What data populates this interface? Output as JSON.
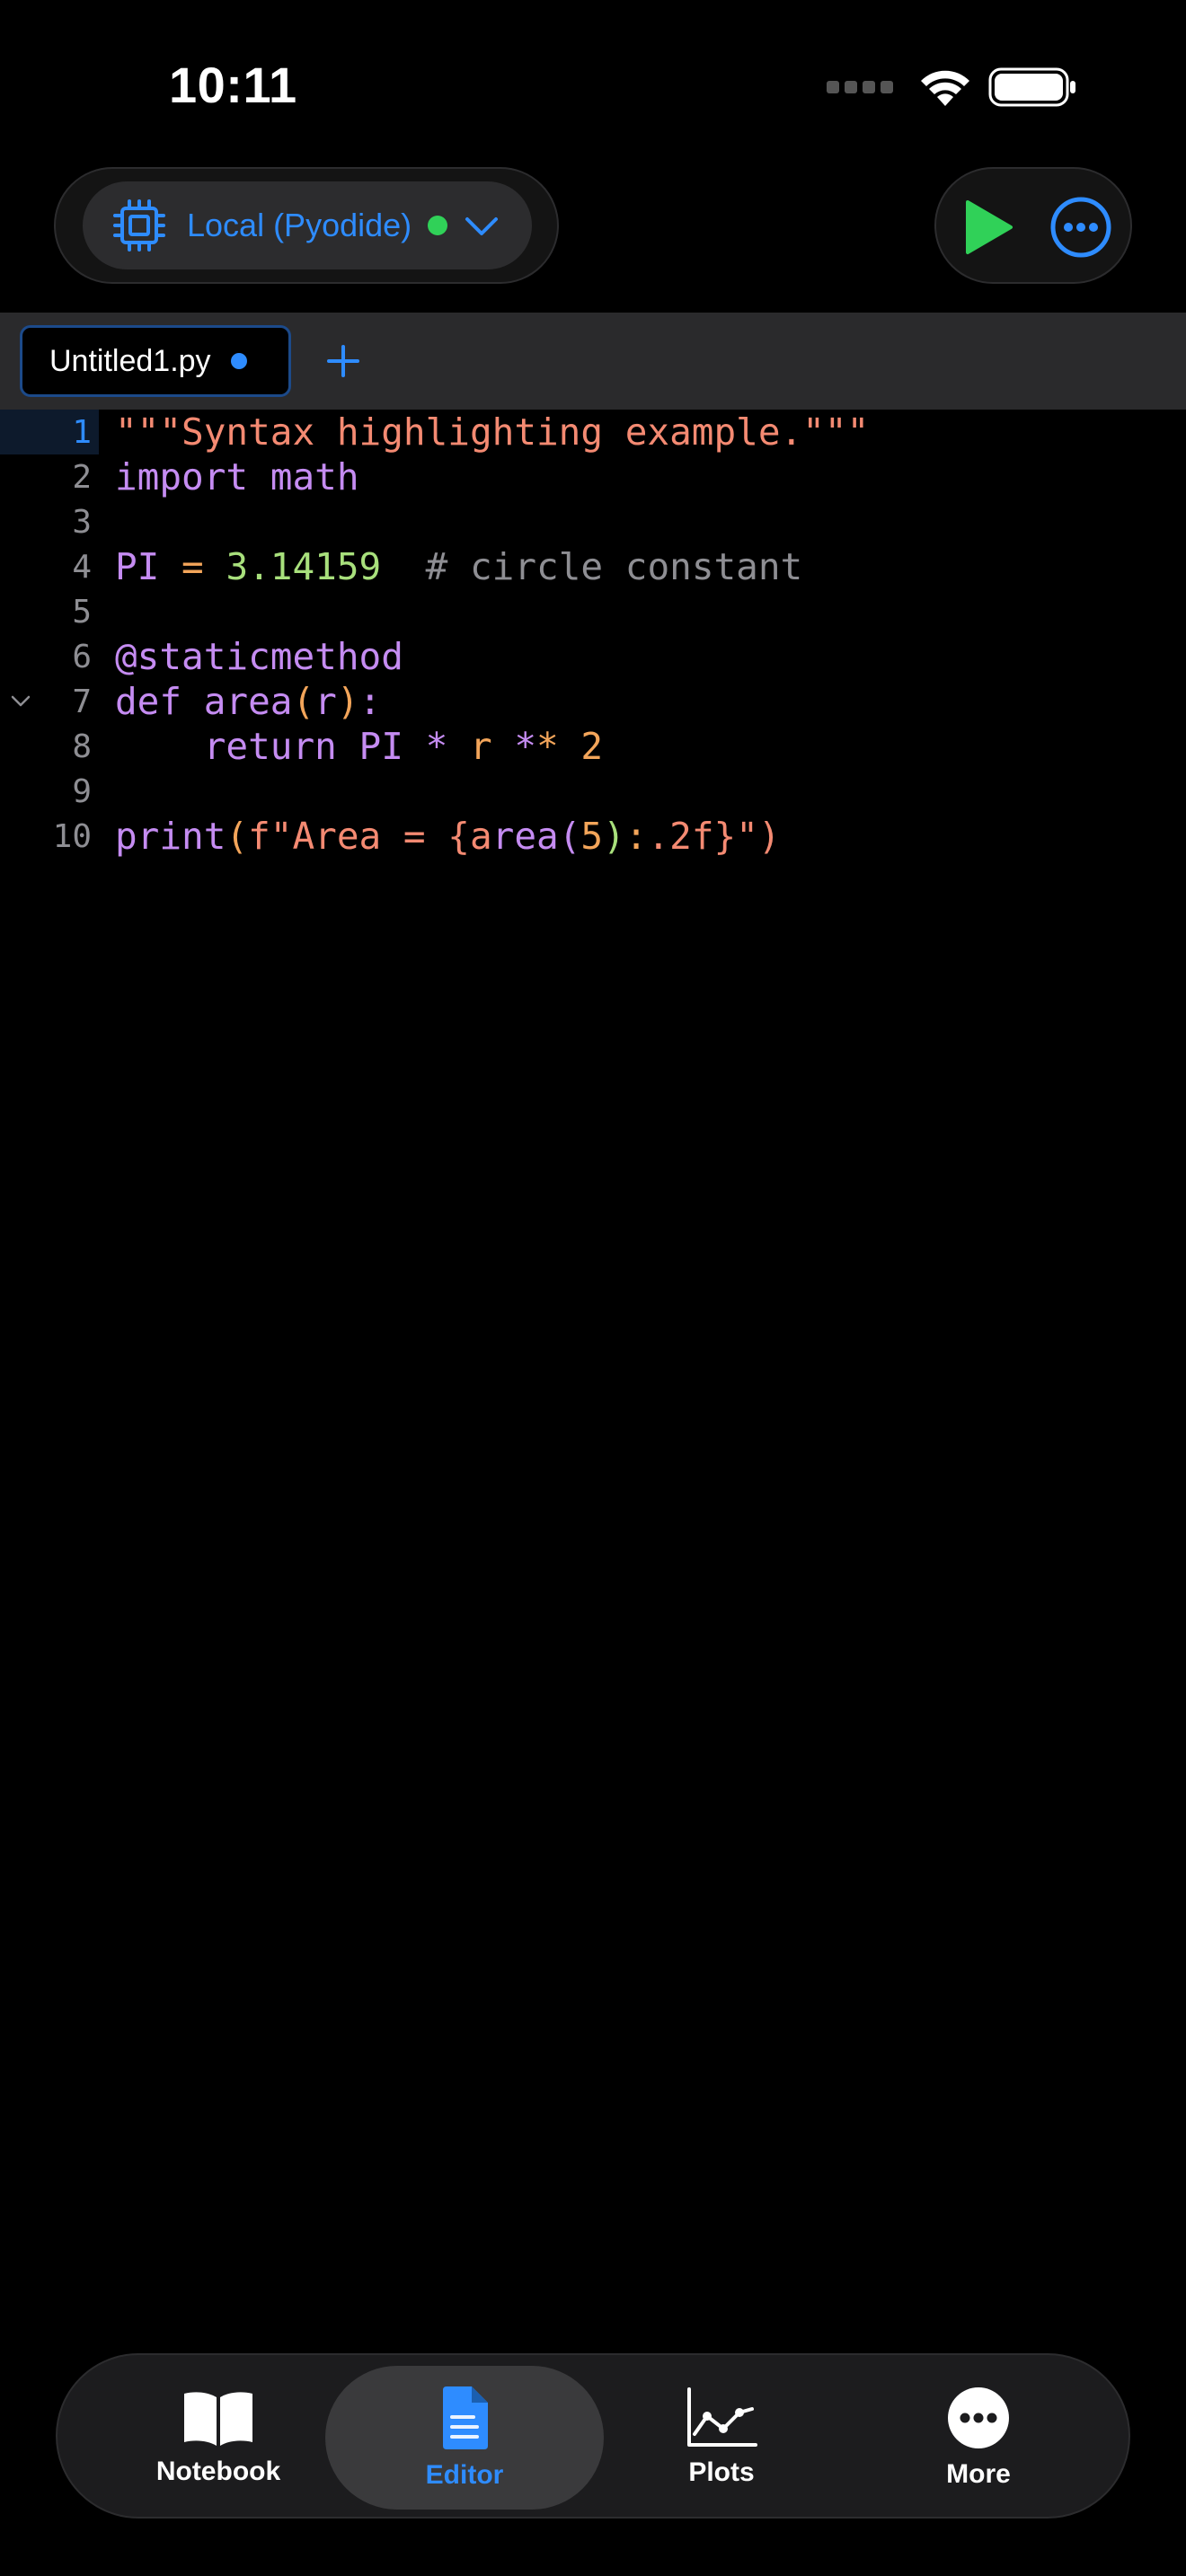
{
  "status_bar": {
    "time": "10:11"
  },
  "toolbar": {
    "kernel_label": "Local (Pyodide)",
    "kernel_status_color": "#30d158",
    "icons": [
      "cpu-icon",
      "chevron-down-icon",
      "run-icon",
      "more-icon"
    ]
  },
  "tabs": {
    "active_file": "Untitled1.py",
    "modified_indicator_color": "#2e8cff"
  },
  "editor": {
    "active_line": 1,
    "line_numbers": [
      "1",
      "2",
      "3",
      "4",
      "5",
      "6",
      "7",
      "8",
      "9",
      "10"
    ],
    "lines": [
      "\"\"\"Syntax highlighting example.\"\"\"",
      "import math",
      "",
      "PI = 3.14159  # circle constant",
      "",
      "@staticmethod",
      "def area(r):",
      "    return PI * r ** 2",
      "",
      "print(f\"Area = {area(5):.2f}\")"
    ]
  },
  "bottom_nav": {
    "items": [
      {
        "label": "Notebook",
        "icon": "book-icon"
      },
      {
        "label": "Editor",
        "icon": "document-icon"
      },
      {
        "label": "Plots",
        "icon": "chart-icon"
      },
      {
        "label": "More",
        "icon": "ellipsis-icon"
      }
    ],
    "active": "Editor"
  }
}
